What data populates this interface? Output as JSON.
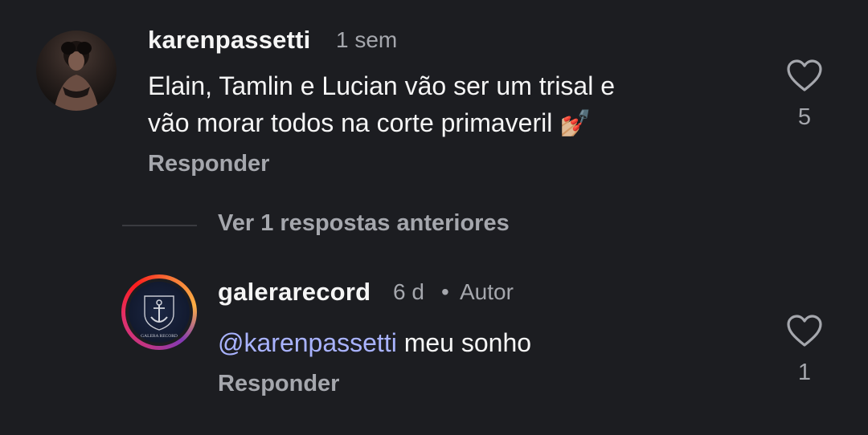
{
  "comments": [
    {
      "username": "karenpassetti",
      "time": "1 sem",
      "text_line1": "Elain, Tamlin e Lucian vão ser um trisal e",
      "text_line2": "vão morar todos na corte primaveril",
      "emoji": "💅🏼",
      "reply_label": "Responder",
      "likes": "5",
      "icon": "heart-outline-icon"
    },
    {
      "username": "galerarecord",
      "time": "6 d",
      "separator": "•",
      "author_badge": "Autor",
      "mention": "@karenpassetti",
      "text": "meu sonho",
      "reply_label": "Responder",
      "likes": "1",
      "icon": "heart-outline-icon",
      "avatar_text": "GALERA RECORD"
    }
  ],
  "view_more": "Ver 1 respostas anteriores",
  "colors": {
    "background": "#1c1d21",
    "text": "#f5f5f5",
    "muted": "#a5a7ad",
    "mention": "#a9b3ff"
  }
}
